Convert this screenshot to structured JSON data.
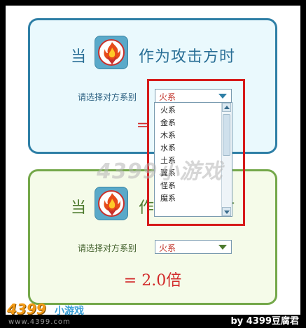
{
  "panels": {
    "attack": {
      "when": "当",
      "role": "作为攻击方时",
      "select_label": "请选择对方系别",
      "selected": "火系",
      "result": "= 0."
    },
    "defense": {
      "when": "当",
      "role": "作为防御方时",
      "select_label": "请选择对方系别",
      "selected": "火系",
      "result": "= 2.0倍"
    }
  },
  "dropdown_options": [
    "火系",
    "金系",
    "木系",
    "水系",
    "土系",
    "翼系",
    "怪系",
    "魔系"
  ],
  "watermark": "4399小游戏",
  "brand": {
    "logo": "4399",
    "tag": "小游戏",
    "url": "www.4399.com"
  },
  "credit": "by 4399豆腐君",
  "colors": {
    "attack_border": "#2e7fa6",
    "defense_border": "#74a84a",
    "result_red": "#d22a2a",
    "highlight": "#d61a1a"
  },
  "icons": {
    "element": "fire-element-icon"
  }
}
